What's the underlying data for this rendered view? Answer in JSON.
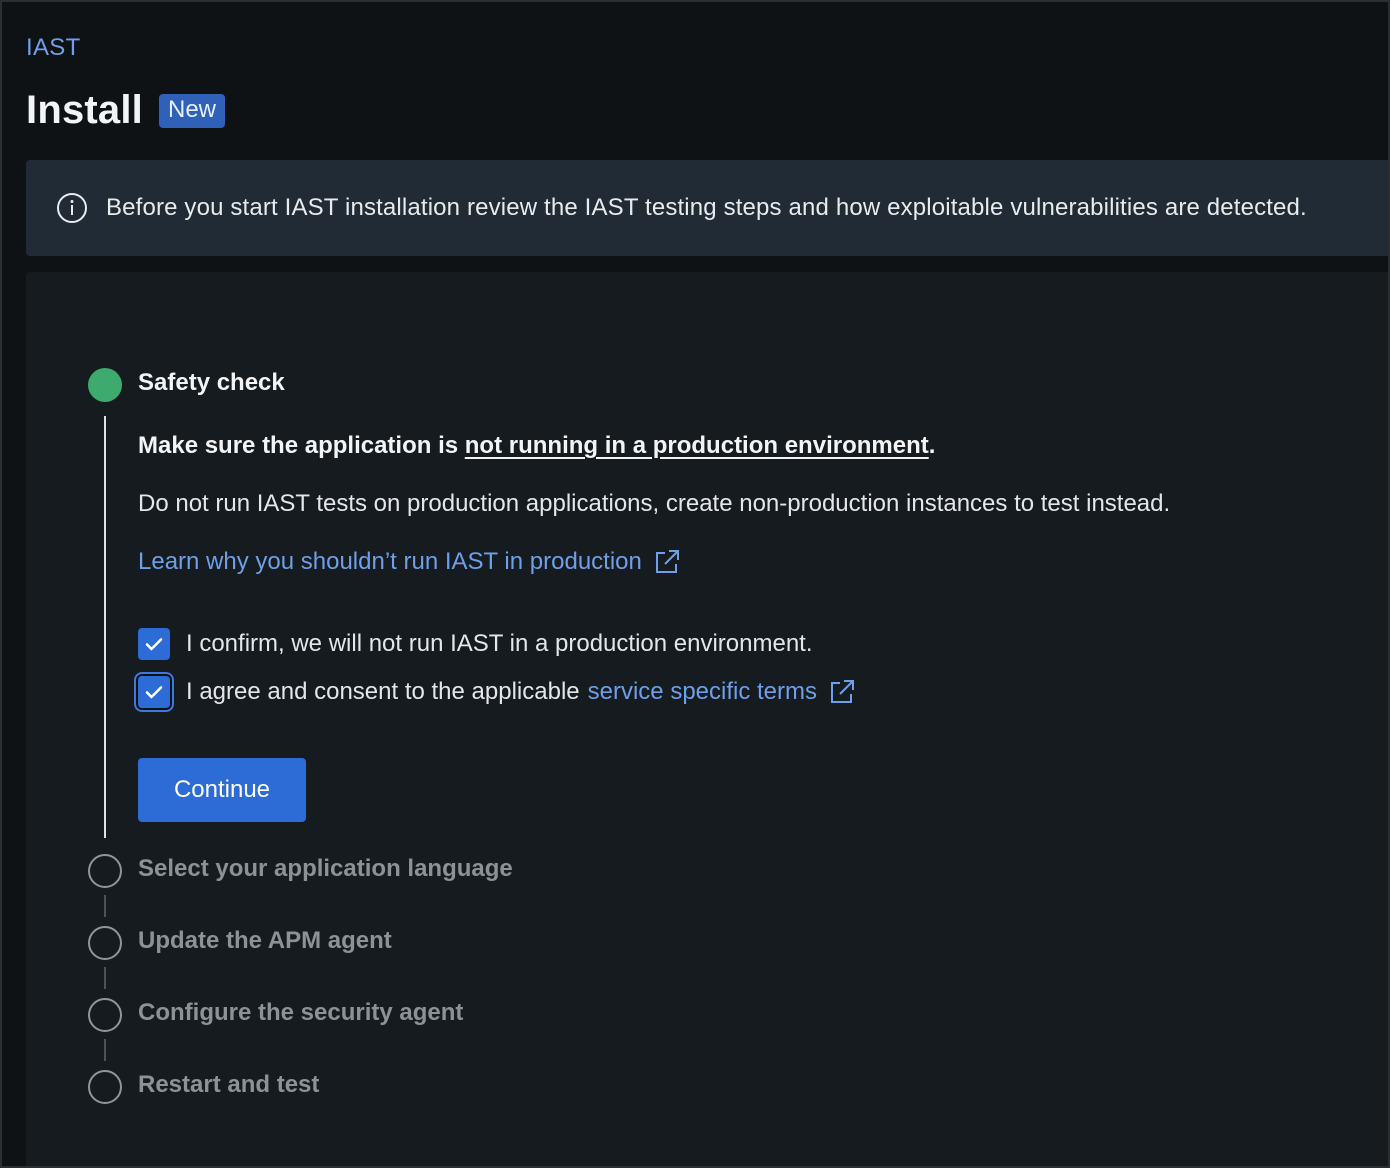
{
  "breadcrumb": "IAST",
  "header": {
    "title": "Install",
    "badge": "New"
  },
  "banner": {
    "text": "Before you start IAST installation review the IAST testing steps and how exploitable vulnerabilities are detected."
  },
  "steps": [
    {
      "title": "Safety check",
      "status": "complete",
      "content": {
        "headline_prefix": "Make sure the application is ",
        "headline_underlined": "not running in a production environment",
        "headline_suffix": ".",
        "description": "Do not run IAST tests on production applications, create non-production instances to test instead.",
        "learn_link": "Learn why you shouldn’t run IAST in production",
        "confirm_label": "I confirm, we will not run IAST in a production environment.",
        "confirm_checked": true,
        "consent_prefix": "I agree and consent to the applicable",
        "consent_link": "service specific terms",
        "consent_checked": true,
        "continue_label": "Continue"
      }
    },
    {
      "title": "Select your application language",
      "status": "pending"
    },
    {
      "title": "Update the APM agent",
      "status": "pending"
    },
    {
      "title": "Configure the security agent",
      "status": "pending"
    },
    {
      "title": "Restart and test",
      "status": "pending"
    }
  ],
  "icons": {
    "info": "info-icon",
    "external": "external-link-icon",
    "check": "checkmark-icon"
  },
  "colors": {
    "accent": "#2d6bd6",
    "link": "#6f9fe8",
    "success": "#3daa6e",
    "background": "#0e1215",
    "banner": "#212b36"
  }
}
